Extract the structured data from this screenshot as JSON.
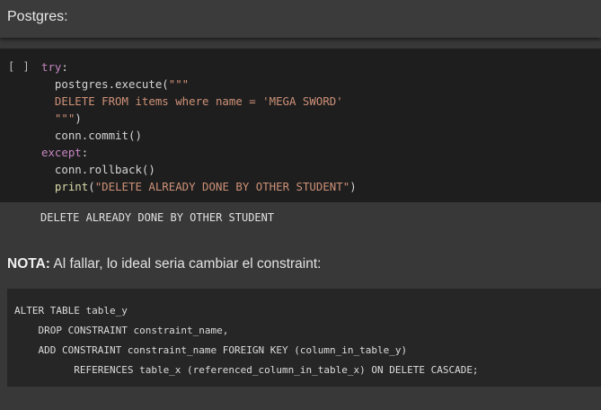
{
  "markdown_header": {
    "title": "Postgres:"
  },
  "code_cell": {
    "run_indicator": "[ ]",
    "lines": {
      "l1_kw": "try",
      "l1_rest": ":",
      "l2": "postgres.execute(",
      "l2_str": "\"\"\"",
      "l3_str": "DELETE FROM items where name = 'MEGA SWORD'",
      "l4_str": "\"\"\"",
      "l4_rest": ")",
      "l5": "conn.commit()",
      "l6_kw": "except",
      "l6_rest": ":",
      "l7": "conn.rollback()",
      "l8_fn": "print",
      "l8_open": "(",
      "l8_str": "\"DELETE ALREADY DONE BY OTHER STUDENT\"",
      "l8_close": ")"
    }
  },
  "output": {
    "text": "DELETE ALREADY DONE BY OTHER STUDENT"
  },
  "nota": {
    "label": "NOTA:",
    "text": " Al fallar, lo ideal seria cambiar el constraint:"
  },
  "sql_block": {
    "line1": "ALTER TABLE table_y",
    "line2": "    DROP CONSTRAINT constraint_name,",
    "line3": "    ADD CONSTRAINT constraint_name FOREIGN KEY (column_in_table_y)",
    "line4": "          REFERENCES table_x (referenced_column_in_table_x) ON DELETE CASCADE;"
  },
  "colors": {
    "background": "#383838",
    "code_background": "#1e1e1e",
    "keyword": "#c586c0",
    "string": "#ce9178",
    "function": "#dcdcaa"
  }
}
